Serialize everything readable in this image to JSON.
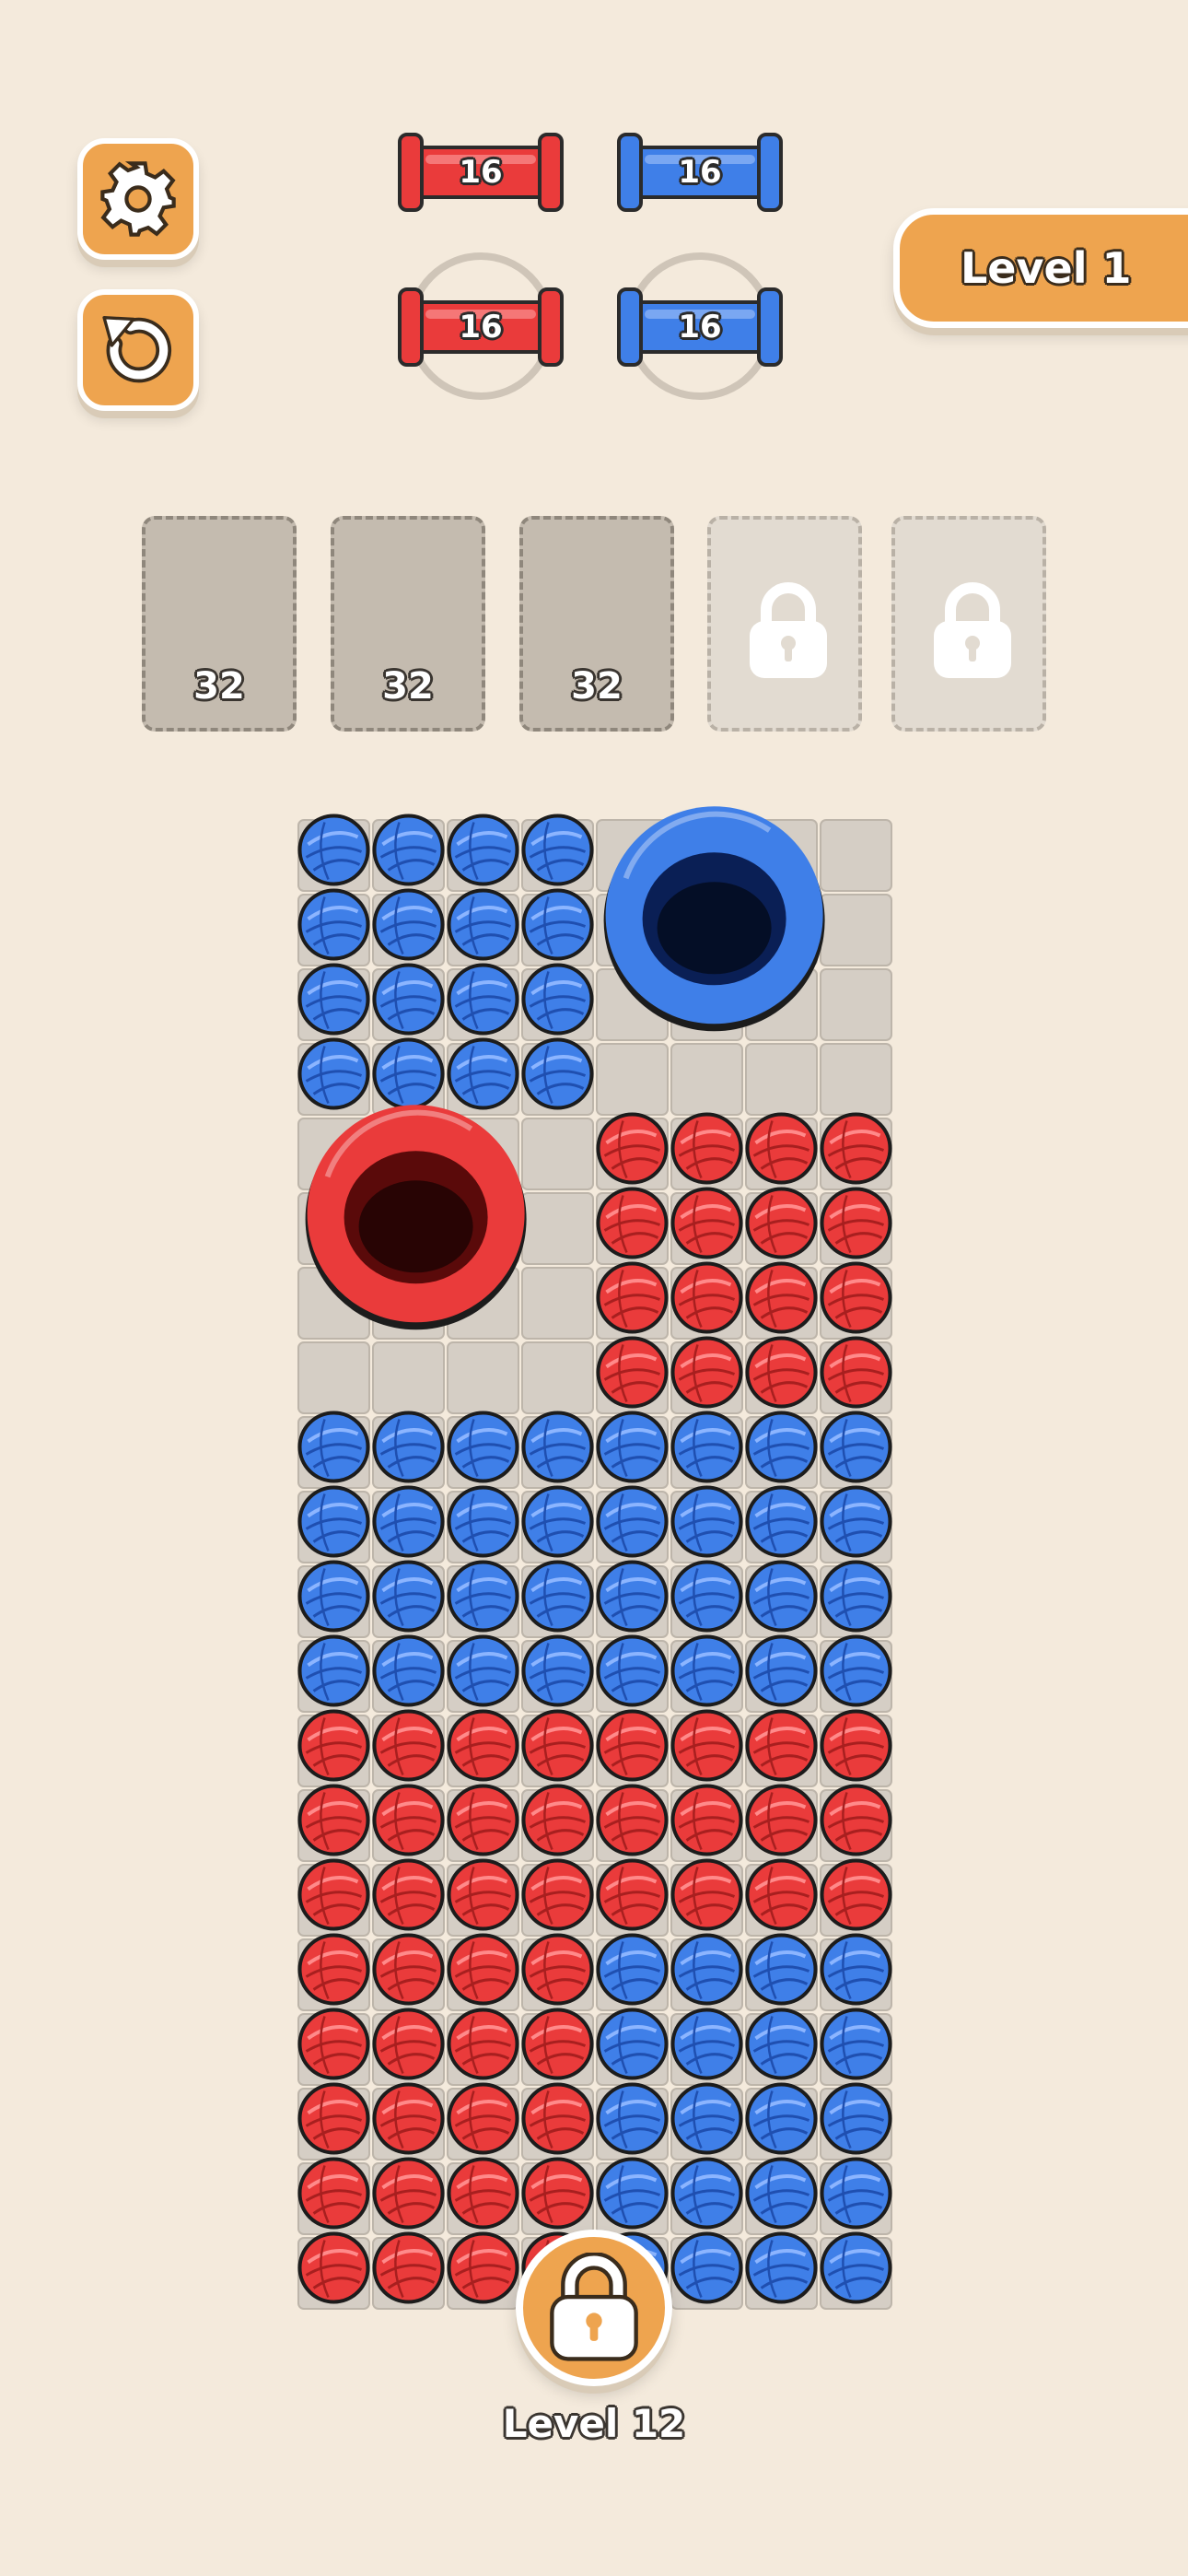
{
  "header": {
    "level_label": "Level 1",
    "settings_icon": "gear-icon",
    "restart_icon": "restart-icon"
  },
  "spools": {
    "top": [
      {
        "color": "red",
        "count": "16"
      },
      {
        "color": "blue",
        "count": "16"
      }
    ],
    "bottom": [
      {
        "color": "red",
        "count": "16"
      },
      {
        "color": "blue",
        "count": "16"
      }
    ]
  },
  "slots": [
    {
      "state": "open",
      "count": "32"
    },
    {
      "state": "open",
      "count": "32"
    },
    {
      "state": "open",
      "count": "32"
    },
    {
      "state": "locked",
      "icon": "lock-icon"
    },
    {
      "state": "locked",
      "icon": "lock-icon"
    }
  ],
  "colors": {
    "red": "#ea3b3b",
    "blue": "#3f7fe8",
    "accent": "#eea44f",
    "tile": "#d5cec5",
    "background": "#f4eadc"
  },
  "board": {
    "columns": 8,
    "rows": 20,
    "grid": [
      "BBBB....",
      "BBBB....",
      "BBBB....",
      "BBBB....",
      "....RRRR",
      "....RRRR",
      "....RRRR",
      "....RRRR",
      "BBBBBBBB",
      "BBBBBBBB",
      "BBBBBBBB",
      "BBBBBBBB",
      "RRRRRRRR",
      "RRRRRRRR",
      "RRRRRRRR",
      "RRRRBBBB",
      "RRRRBBBB",
      "RRRRBBBB",
      "RRRRBBBB",
      "RRRRBBBB"
    ],
    "holes": [
      {
        "color": "blue",
        "col_start": 4,
        "row_start": 0,
        "size": 3
      },
      {
        "color": "red",
        "col_start": 0,
        "row_start": 4,
        "size": 3
      }
    ]
  },
  "footer": {
    "unlock_icon": "lock-icon",
    "next_level_label": "Level 12"
  }
}
